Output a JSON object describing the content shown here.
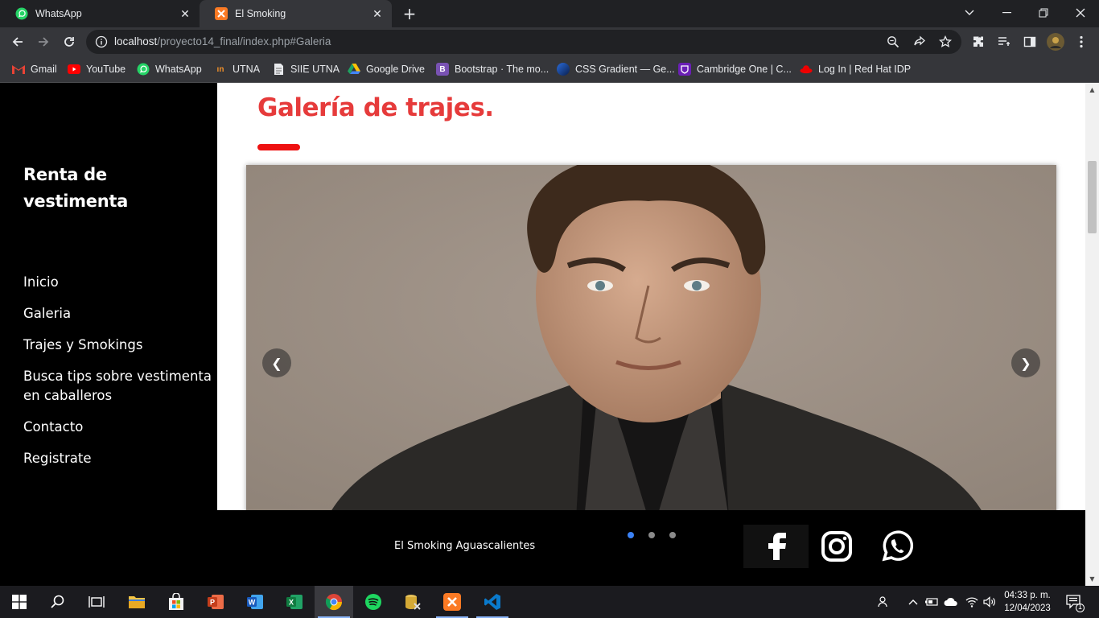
{
  "browser": {
    "tabs": [
      {
        "title": "WhatsApp",
        "icon": "whatsapp-icon"
      },
      {
        "title": "El Smoking",
        "icon": "xampp-icon"
      }
    ],
    "url_host": "localhost",
    "url_path": "/proyecto14_final/index.php#Galeria",
    "bookmarks": [
      {
        "label": "Gmail",
        "icon": "gmail-icon"
      },
      {
        "label": "YouTube",
        "icon": "youtube-icon"
      },
      {
        "label": "WhatsApp",
        "icon": "whatsapp-icon"
      },
      {
        "label": "UTNA",
        "icon": "utna-icon"
      },
      {
        "label": "SIIE UTNA",
        "icon": "document-icon"
      },
      {
        "label": "Google Drive",
        "icon": "google-drive-icon"
      },
      {
        "label": "Bootstrap · The mo...",
        "icon": "bootstrap-icon"
      },
      {
        "label": "CSS Gradient — Ge...",
        "icon": "css-gradient-icon"
      },
      {
        "label": "Cambridge One | C...",
        "icon": "cambridge-icon"
      },
      {
        "label": "Log In | Red Hat IDP",
        "icon": "redhat-icon"
      }
    ]
  },
  "site": {
    "brand": "Renta de vestimenta",
    "nav": [
      "Inicio",
      "Galeria",
      "Trajes y Smokings",
      "Busca tips sobre vestimenta en caballeros",
      "Contacto",
      "Registrate"
    ],
    "gallery_title": "Galería de trajes.",
    "carousel": {
      "prev_label": "❮",
      "next_label": "❯",
      "slide_count": 3,
      "active_slide": 1
    },
    "footer_text": "El Smoking Aguascalientes",
    "social": [
      "facebook-icon",
      "instagram-icon",
      "whatsapp-icon"
    ]
  },
  "taskbar": {
    "time": "04:33 p. m.",
    "date": "12/04/2023",
    "notification_count": "1"
  },
  "colors": {
    "accent_red": "#e63b3b",
    "title_bar_red": "#ee1111",
    "dot_active": "#3b82f6",
    "sidebar_bg": "#000000"
  }
}
